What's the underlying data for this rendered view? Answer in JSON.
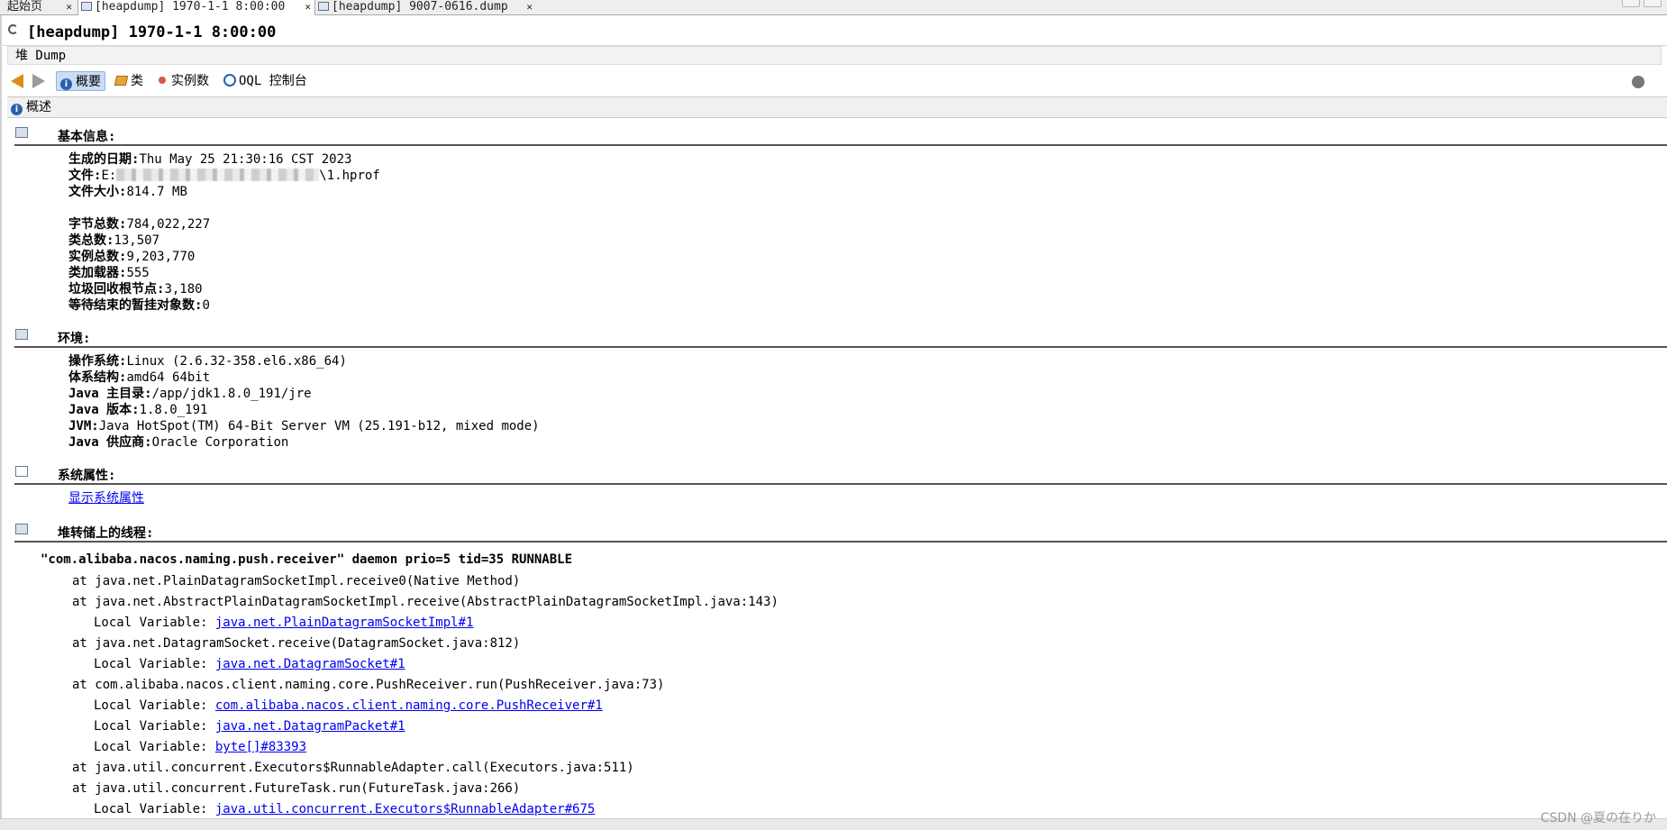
{
  "tabs": [
    {
      "label": "起始页",
      "active": false
    },
    {
      "label": "[heapdump] 1970-1-1 8:00:00",
      "active": true
    },
    {
      "label": "[heapdump] 9007-0616.dump",
      "active": false
    }
  ],
  "title": "[heapdump] 1970-1-1 8:00:00",
  "subtab": "堆 Dump",
  "toolbar": {
    "summary": "概要",
    "classes": "类",
    "instances": "实例数",
    "oql": "OQL 控制台"
  },
  "section_header": "概述",
  "basic": {
    "title": "基本信息:",
    "date_k": "生成的日期:",
    "date_v": "Thu May 25 21:30:16 CST 2023",
    "file_k": "文件:",
    "file_prefix": "E:",
    "file_suffix": "\\1.hprof",
    "size_k": "文件大小:",
    "size_v": "814.7 MB",
    "bytes_k": "字节总数:",
    "bytes_v": "784,022,227",
    "classes_k": "类总数:",
    "classes_v": "13,507",
    "inst_k": "实例总数:",
    "inst_v": "9,203,770",
    "loaders_k": "类加载器:",
    "loaders_v": "555",
    "gc_k": "垃圾回收根节点:",
    "gc_v": "3,180",
    "final_k": "等待结束的暂挂对象数:",
    "final_v": "0"
  },
  "env": {
    "title": "环境:",
    "os_k": "操作系统:",
    "os_v": "Linux (2.6.32-358.el6.x86_64)",
    "arch_k": "体系结构:",
    "arch_v": "amd64 64bit",
    "home_k": "Java 主目录:",
    "home_v": "/app/jdk1.8.0_191/jre",
    "ver_k": "Java 版本:",
    "ver_v": "1.8.0_191",
    "jvm_k": "JVM:",
    "jvm_v": "Java HotSpot(TM) 64-Bit Server VM (25.191-b12, mixed mode)",
    "vendor_k": "Java 供应商:",
    "vendor_v": "Oracle Corporation"
  },
  "sysprops": {
    "title": "系统属性:",
    "link": "显示系统属性"
  },
  "threads": {
    "title": "堆转储上的线程:",
    "thread_header": "\"com.alibaba.nacos.naming.push.receiver\" daemon prio=5 tid=35 RUNNABLE",
    "lines": [
      {
        "type": "at",
        "text": "at java.net.PlainDatagramSocketImpl.receive0(Native Method)"
      },
      {
        "type": "at",
        "text": "at java.net.AbstractPlainDatagramSocketImpl.receive(AbstractPlainDatagramSocketImpl.java:143)"
      },
      {
        "type": "lv",
        "label": "Local Variable: ",
        "link": "java.net.PlainDatagramSocketImpl#1"
      },
      {
        "type": "at",
        "text": "at java.net.DatagramSocket.receive(DatagramSocket.java:812)"
      },
      {
        "type": "lv",
        "label": "Local Variable: ",
        "link": "java.net.DatagramSocket#1"
      },
      {
        "type": "at",
        "text": "at com.alibaba.nacos.client.naming.core.PushReceiver.run(PushReceiver.java:73)"
      },
      {
        "type": "lv",
        "label": "Local Variable: ",
        "link": "com.alibaba.nacos.client.naming.core.PushReceiver#1"
      },
      {
        "type": "lv",
        "label": "Local Variable: ",
        "link": "java.net.DatagramPacket#1"
      },
      {
        "type": "lv",
        "label": "Local Variable: ",
        "link": "byte[]#83393"
      },
      {
        "type": "at",
        "text": "at java.util.concurrent.Executors$RunnableAdapter.call(Executors.java:511)"
      },
      {
        "type": "at",
        "text": "at java.util.concurrent.FutureTask.run(FutureTask.java:266)"
      },
      {
        "type": "lv",
        "label": "Local Variable: ",
        "link": "java.util.concurrent.Executors$RunnableAdapter#675"
      }
    ]
  },
  "watermark": "CSDN @夏の在りか"
}
